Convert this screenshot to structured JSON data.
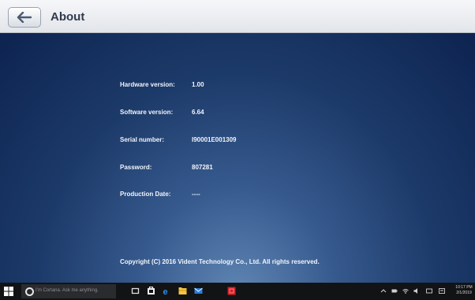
{
  "header": {
    "title": "About"
  },
  "about": {
    "rows": [
      {
        "label": "Hardware version:",
        "value": "1.00"
      },
      {
        "label": "Software version:",
        "value": "6.64"
      },
      {
        "label": "Serial number:",
        "value": "I90001E001309"
      },
      {
        "label": "Password:",
        "value": "807281"
      },
      {
        "label": "Production Date:",
        "value": "----"
      }
    ],
    "copyright": "Copyright (C) 2016 Vident Technology  Co., Ltd. All rights reserved."
  },
  "taskbar": {
    "search_placeholder": "I'm Cortana. Ask me anything.",
    "clock_time": "10:17 PM",
    "clock_date": "2/1/2019"
  },
  "colors": {
    "header_bg": "#eceef1",
    "content_bg": "#1c3a69",
    "taskbar_bg": "#121314",
    "text": "#f2f5fa"
  }
}
